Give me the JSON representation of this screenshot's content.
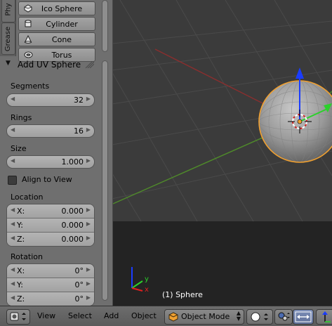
{
  "shelf": {
    "tabs": [
      "Phy",
      "Grease"
    ],
    "add_buttons": [
      {
        "label": "Ico Sphere",
        "icon": "ico-sphere-icon"
      },
      {
        "label": "Cylinder",
        "icon": "cylinder-icon"
      },
      {
        "label": "Cone",
        "icon": "cone-icon"
      },
      {
        "label": "Torus",
        "icon": "torus-icon"
      }
    ]
  },
  "operator": {
    "title": "Add UV Sphere",
    "segments": {
      "label": "Segments",
      "value": "32"
    },
    "rings": {
      "label": "Rings",
      "value": "16"
    },
    "size": {
      "label": "Size",
      "value": "1.000"
    },
    "align_to_view": {
      "label": "Align to View",
      "checked": false
    },
    "location": {
      "label": "Location",
      "axes": [
        {
          "axis": "X:",
          "value": "0.000"
        },
        {
          "axis": "Y:",
          "value": "0.000"
        },
        {
          "axis": "Z:",
          "value": "0.000"
        }
      ]
    },
    "rotation": {
      "label": "Rotation",
      "axes": [
        {
          "axis": "X:",
          "value": "0°"
        },
        {
          "axis": "Y:",
          "value": "0°"
        },
        {
          "axis": "Z:",
          "value": "0°"
        }
      ]
    }
  },
  "viewport": {
    "object_label": "(1) Sphere",
    "axis_letters": {
      "x": "x",
      "y": "y"
    }
  },
  "header": {
    "menus": [
      "View",
      "Select",
      "Add",
      "Object"
    ],
    "mode": "Object Mode"
  },
  "colors": {
    "selection_outline": "#f0a030",
    "grid_x_axis": "#8a2e2e",
    "grid_y_axis": "#4f8a2a",
    "gizmo_z": "#1a3cff",
    "gizmo_y": "#2bd12b",
    "gizmo_x": "#e02020"
  }
}
